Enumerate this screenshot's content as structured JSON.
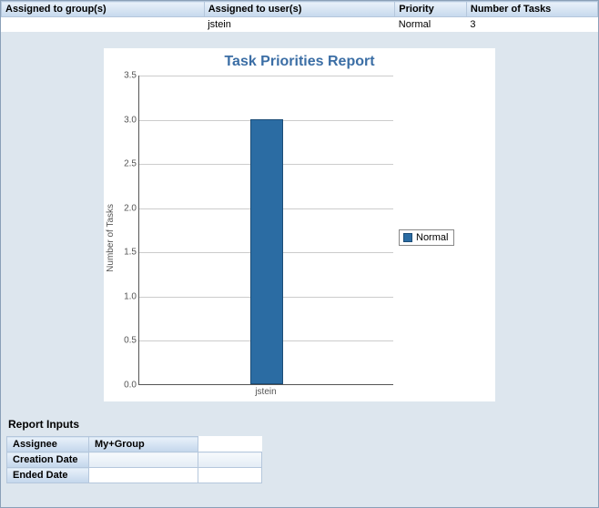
{
  "table": {
    "headers": [
      "Assigned to group(s)",
      "Assigned to user(s)",
      "Priority",
      "Number of Tasks"
    ],
    "rows": [
      {
        "group": "",
        "user": "jstein",
        "priority": "Normal",
        "count": "3"
      }
    ]
  },
  "chart_data": {
    "type": "bar",
    "title": "Task Priorities Report",
    "xlabel": "",
    "ylabel": "Number of Tasks",
    "ylim": [
      0.0,
      3.5
    ],
    "yticks": [
      0.0,
      0.5,
      1.0,
      1.5,
      2.0,
      2.5,
      3.0,
      3.5
    ],
    "categories": [
      "jstein"
    ],
    "series": [
      {
        "name": "Normal",
        "values": [
          3
        ],
        "color": "#2b6ca3"
      }
    ]
  },
  "inputs": {
    "heading": "Report Inputs",
    "rows": [
      {
        "label": "Assignee",
        "value": "My+Group"
      },
      {
        "label": "Creation Date",
        "value": ""
      },
      {
        "label": "Ended Date",
        "value": ""
      }
    ]
  }
}
